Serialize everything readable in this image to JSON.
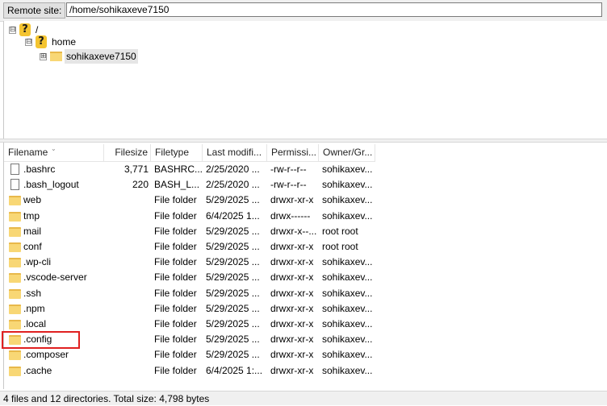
{
  "remote_site": {
    "label": "Remote site:",
    "path": "/home/sohikaxeve7150"
  },
  "tree": {
    "root": {
      "label": "/",
      "expander": "⊟",
      "icon": "question-folder-icon"
    },
    "home": {
      "label": "home",
      "expander": "⊟",
      "icon": "question-folder-icon"
    },
    "user": {
      "label": "sohikaxeve7150",
      "expander": "⊞",
      "icon": "folder-icon"
    }
  },
  "columns": [
    "Filename",
    "Filesize",
    "Filetype",
    "Last modifi...",
    "Permissi...",
    "Owner/Gr..."
  ],
  "rows": [
    {
      "icon": "file-icon",
      "name": ".bashrc",
      "size": "3,771",
      "type": "BASHRC...",
      "modified": "2/25/2020 ...",
      "perms": "-rw-r--r--",
      "owner": "sohikaxev..."
    },
    {
      "icon": "file-icon",
      "name": ".bash_logout",
      "size": "220",
      "type": "BASH_L...",
      "modified": "2/25/2020 ...",
      "perms": "-rw-r--r--",
      "owner": "sohikaxev..."
    },
    {
      "icon": "folder-icon",
      "name": "web",
      "size": "",
      "type": "File folder",
      "modified": "5/29/2025 ...",
      "perms": "drwxr-xr-x",
      "owner": "sohikaxev..."
    },
    {
      "icon": "folder-icon",
      "name": "tmp",
      "size": "",
      "type": "File folder",
      "modified": "6/4/2025 1...",
      "perms": "drwx------",
      "owner": "sohikaxev..."
    },
    {
      "icon": "folder-icon",
      "name": "mail",
      "size": "",
      "type": "File folder",
      "modified": "5/29/2025 ...",
      "perms": "drwxr-x--...",
      "owner": "root root"
    },
    {
      "icon": "folder-icon",
      "name": "conf",
      "size": "",
      "type": "File folder",
      "modified": "5/29/2025 ...",
      "perms": "drwxr-xr-x",
      "owner": "root root"
    },
    {
      "icon": "folder-icon",
      "name": ".wp-cli",
      "size": "",
      "type": "File folder",
      "modified": "5/29/2025 ...",
      "perms": "drwxr-xr-x",
      "owner": "sohikaxev..."
    },
    {
      "icon": "folder-icon",
      "name": ".vscode-server",
      "size": "",
      "type": "File folder",
      "modified": "5/29/2025 ...",
      "perms": "drwxr-xr-x",
      "owner": "sohikaxev..."
    },
    {
      "icon": "folder-icon",
      "name": ".ssh",
      "size": "",
      "type": "File folder",
      "modified": "5/29/2025 ...",
      "perms": "drwxr-xr-x",
      "owner": "sohikaxev..."
    },
    {
      "icon": "folder-icon",
      "name": ".npm",
      "size": "",
      "type": "File folder",
      "modified": "5/29/2025 ...",
      "perms": "drwxr-xr-x",
      "owner": "sohikaxev..."
    },
    {
      "icon": "folder-icon",
      "name": ".local",
      "size": "",
      "type": "File folder",
      "modified": "5/29/2025 ...",
      "perms": "drwxr-xr-x",
      "owner": "sohikaxev..."
    },
    {
      "icon": "folder-icon",
      "name": ".config",
      "size": "",
      "type": "File folder",
      "modified": "5/29/2025 ...",
      "perms": "drwxr-xr-x",
      "owner": "sohikaxev..."
    },
    {
      "icon": "folder-icon",
      "name": ".composer",
      "size": "",
      "type": "File folder",
      "modified": "5/29/2025 ...",
      "perms": "drwxr-xr-x",
      "owner": "sohikaxev..."
    },
    {
      "icon": "folder-icon",
      "name": ".cache",
      "size": "",
      "type": "File folder",
      "modified": "6/4/2025 1:...",
      "perms": "drwxr-xr-x",
      "owner": "sohikaxev..."
    }
  ],
  "highlight_color": "#e02020",
  "status_text": "4 files and 12 directories. Total size: 4,798 bytes"
}
